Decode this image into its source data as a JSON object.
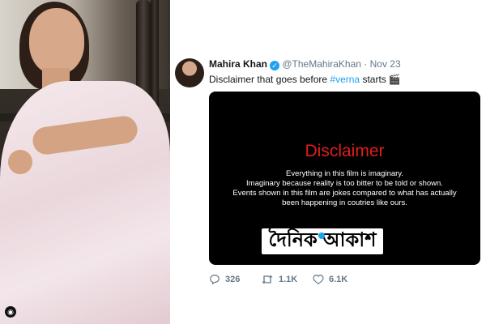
{
  "tweet": {
    "author_name": "Mahira Khan",
    "handle": "@TheMahiraKhan",
    "separator": "·",
    "date": "Nov 23",
    "verified_mark": "✓",
    "text_before": "Disclaimer that goes before ",
    "hashtag": "#verna",
    "text_after": " starts",
    "emoji": "🎬"
  },
  "media": {
    "title": "Disclaimer",
    "lines": [
      "Everything in this film is imaginary.",
      "Imaginary because reality is too bitter to be told or shown.",
      "Events shown in this film are jokes compared to what has actually",
      "been happening in coutries like ours."
    ],
    "watermark": "দৈনিক আকাশ"
  },
  "actions": {
    "replies": "326",
    "retweets": "1.1K",
    "likes": "6.1K"
  },
  "icons": {
    "reply": "reply-icon",
    "retweet": "retweet-icon",
    "like": "heart-icon",
    "instagram": "instagram-icon"
  },
  "colors": {
    "link": "#1da1f2",
    "disclaimer_red": "#e01e1e",
    "media_bg": "#000000"
  }
}
